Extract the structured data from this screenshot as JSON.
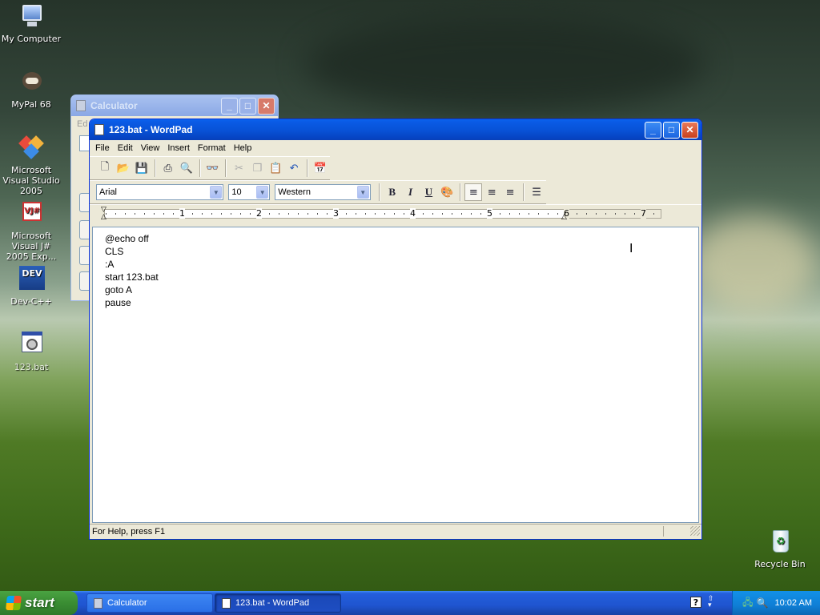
{
  "desktop": {
    "icons": [
      {
        "label": "My Computer"
      },
      {
        "label": "MyPal 68"
      },
      {
        "label": "Microsoft Visual Studio 2005"
      },
      {
        "label": "Microsoft Visual J# 2005 Exp..."
      },
      {
        "label": "Dev-C++"
      },
      {
        "label": "123.bat"
      },
      {
        "label": "Recycle Bin"
      }
    ]
  },
  "calculator": {
    "title": "Calculator",
    "menu_partial": "Ed"
  },
  "wordpad": {
    "title": "123.bat - WordPad",
    "menu": [
      "File",
      "Edit",
      "View",
      "Insert",
      "Format",
      "Help"
    ],
    "font": "Arial",
    "size": "10",
    "script": "Western",
    "ruler_numbers": [
      "1",
      "2",
      "3",
      "4",
      "5",
      "6",
      "7"
    ],
    "document_lines": [
      "@echo off",
      "CLS",
      ":A",
      "start 123.bat",
      "goto A",
      "pause"
    ],
    "status": "For Help, press F1"
  },
  "taskbar": {
    "start_label": "start",
    "items": [
      {
        "label": "Calculator"
      },
      {
        "label": "123.bat - WordPad"
      }
    ],
    "clock": "10:02 AM"
  },
  "colors": {
    "title_active": "#0a5fe8",
    "title_inactive": "#9db8eb",
    "taskbar": "#245edb",
    "start_green": "#3a8d33"
  }
}
